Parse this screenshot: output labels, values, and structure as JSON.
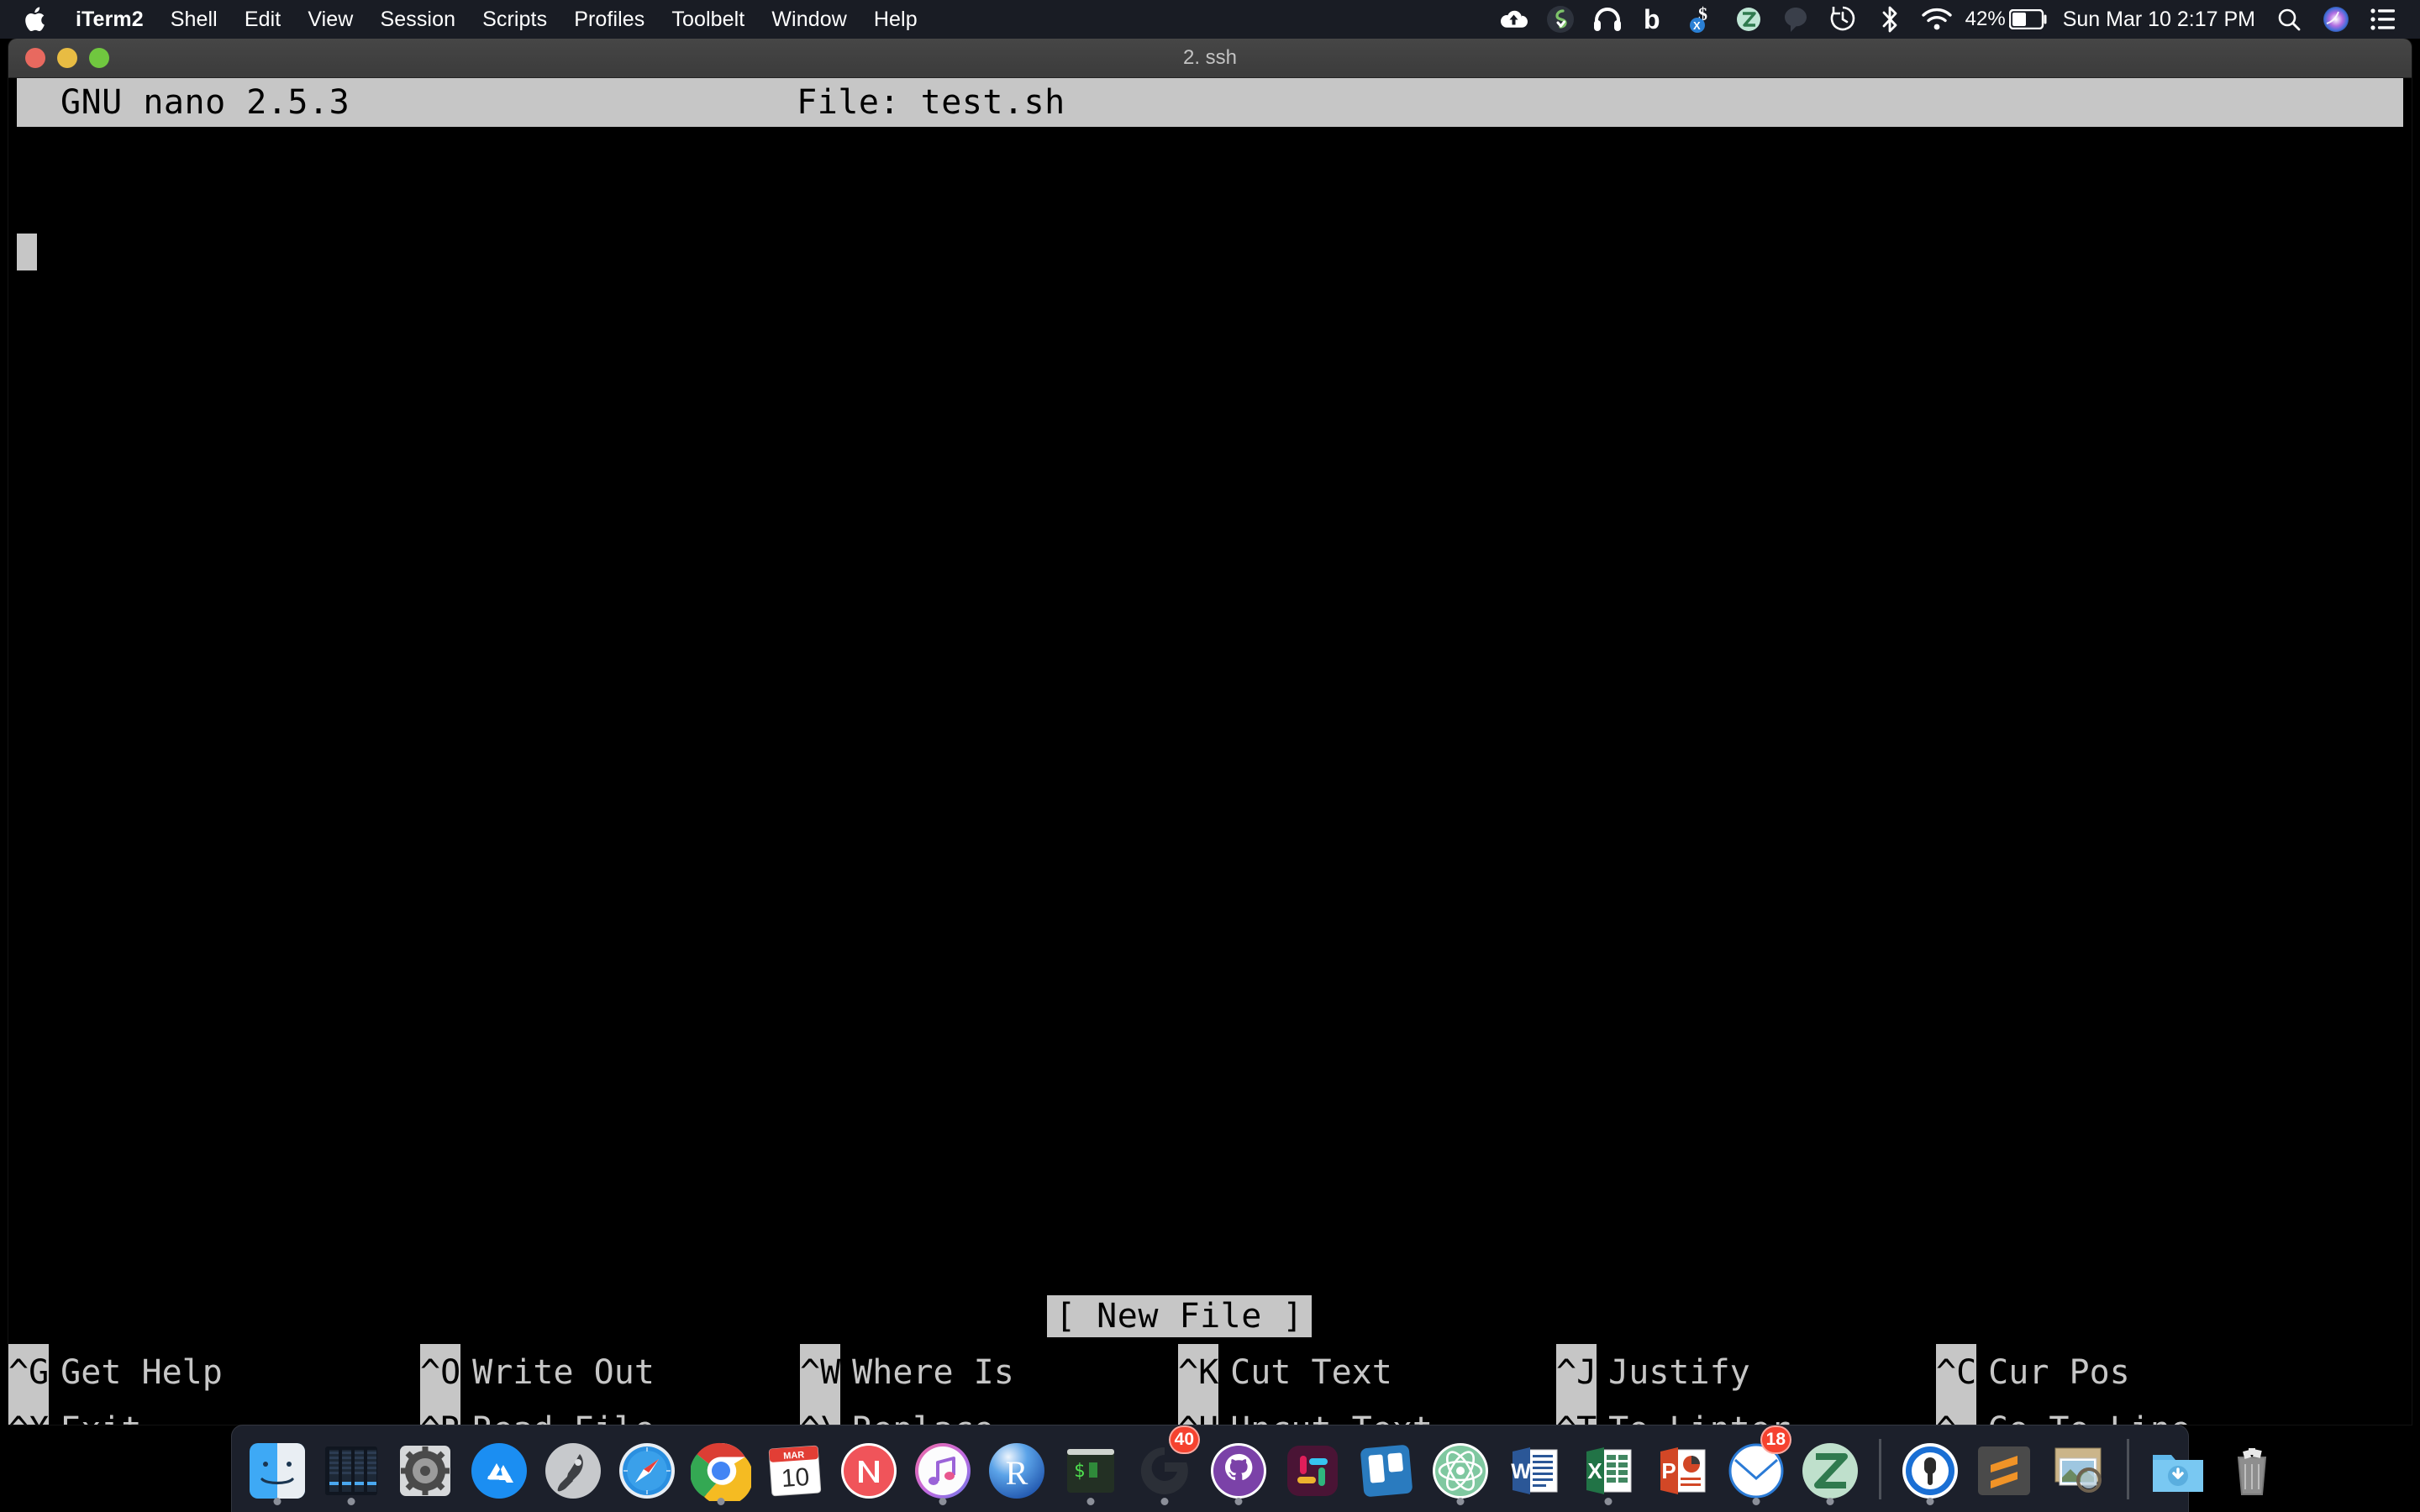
{
  "menubar": {
    "apple_icon": "apple-logo-icon",
    "items": [
      {
        "label": "iTerm2",
        "bold": true
      },
      {
        "label": "Shell",
        "bold": false
      },
      {
        "label": "Edit",
        "bold": false
      },
      {
        "label": "View",
        "bold": false
      },
      {
        "label": "Session",
        "bold": false
      },
      {
        "label": "Scripts",
        "bold": false
      },
      {
        "label": "Profiles",
        "bold": false
      },
      {
        "label": "Toolbelt",
        "bold": false
      },
      {
        "label": "Window",
        "bold": false
      },
      {
        "label": "Help",
        "bold": false
      }
    ],
    "status_icons": [
      {
        "name": "cloud-upload-icon"
      },
      {
        "name": "spotify-like-green-s-icon"
      },
      {
        "name": "headphones-icon"
      },
      {
        "name": "backblaze-b-icon"
      },
      {
        "name": "dollar-sign-x-icon"
      },
      {
        "name": "zotero-z-icon"
      },
      {
        "name": "speech-bubble-icon"
      },
      {
        "name": "time-machine-clock-icon"
      },
      {
        "name": "bluetooth-icon"
      },
      {
        "name": "wifi-icon"
      }
    ],
    "battery_percent": "42%",
    "battery_icon": "battery-icon",
    "datetime": "Sun Mar 10  2:17 PM",
    "search_icon": "search-icon",
    "siri_icon": "siri-icon",
    "control_center_icon": "notification-center-icon"
  },
  "window": {
    "title": "2. ssh",
    "traffic_lights": [
      {
        "name": "close-button",
        "color": "#e8695f"
      },
      {
        "name": "minimize-button",
        "color": "#e8bc43"
      },
      {
        "name": "zoom-button",
        "color": "#70c73f"
      }
    ]
  },
  "nano": {
    "version_text": "GNU nano 2.5.3",
    "file_text": "File: test.sh",
    "status_message": "[ New File ]",
    "buffer_lines": [],
    "colors": {
      "background": "#000000",
      "inverted_background": "#c6c6c6",
      "foreground": "#c6c6c6",
      "inverted_foreground": "#000000"
    },
    "shortcuts_row1": [
      {
        "key": "^G",
        "label": "Get Help"
      },
      {
        "key": "^O",
        "label": "Write Out"
      },
      {
        "key": "^W",
        "label": "Where Is"
      },
      {
        "key": "^K",
        "label": "Cut Text"
      },
      {
        "key": "^J",
        "label": "Justify"
      },
      {
        "key": "^C",
        "label": "Cur Pos"
      }
    ],
    "shortcuts_row2": [
      {
        "key": "^X",
        "label": "Exit"
      },
      {
        "key": "^R",
        "label": "Read File"
      },
      {
        "key": "^\\",
        "label": "Replace"
      },
      {
        "key": "^U",
        "label": "Uncut Text"
      },
      {
        "key": "^T",
        "label": "To Linter"
      },
      {
        "key": "^_",
        "label": "Go To Line"
      }
    ]
  },
  "dock": {
    "items": [
      {
        "name": "finder",
        "icon": "finder-icon",
        "running": true
      },
      {
        "name": "activity-monitor",
        "icon": "activity-monitor-icon",
        "running": true
      },
      {
        "name": "system-preferences",
        "icon": "system-preferences-icon",
        "running": false
      },
      {
        "name": "app-store",
        "icon": "app-store-icon",
        "running": false
      },
      {
        "name": "launchpad",
        "icon": "launchpad-icon",
        "running": false
      },
      {
        "name": "safari",
        "icon": "safari-icon",
        "running": false
      },
      {
        "name": "google-chrome",
        "icon": "chrome-icon",
        "running": true
      },
      {
        "name": "calendar",
        "icon": "calendar-icon",
        "running": false,
        "month": "MAR",
        "day": "10"
      },
      {
        "name": "news",
        "icon": "news-icon",
        "running": false
      },
      {
        "name": "itunes",
        "icon": "itunes-icon",
        "running": true
      },
      {
        "name": "rstudio",
        "icon": "rstudio-icon",
        "running": false
      },
      {
        "name": "iterm2",
        "icon": "terminal-icon",
        "running": true
      },
      {
        "name": "gmail",
        "icon": "gmail-g-icon",
        "running": true,
        "badge": "40"
      },
      {
        "name": "github-desktop",
        "icon": "github-icon",
        "running": true
      },
      {
        "name": "slack",
        "icon": "slack-icon",
        "running": false
      },
      {
        "name": "trello",
        "icon": "trello-icon",
        "running": false
      },
      {
        "name": "atom",
        "icon": "atom-icon",
        "running": true
      },
      {
        "name": "microsoft-word",
        "icon": "word-icon",
        "running": false
      },
      {
        "name": "microsoft-excel",
        "icon": "excel-icon",
        "running": true
      },
      {
        "name": "microsoft-powerpoint",
        "icon": "powerpoint-icon",
        "running": false
      },
      {
        "name": "outlook",
        "icon": "outlook-icon",
        "running": true,
        "badge": "18"
      },
      {
        "name": "zotero",
        "icon": "zotero-icon",
        "running": true
      },
      {
        "name": "separator-1",
        "icon": "dock-divider",
        "running": false
      },
      {
        "name": "1password",
        "icon": "1password-icon",
        "running": true
      },
      {
        "name": "sublime-text",
        "icon": "sublime-text-icon",
        "running": false
      },
      {
        "name": "preview",
        "icon": "preview-icon",
        "running": false
      },
      {
        "name": "separator-2",
        "icon": "dock-divider",
        "running": false
      },
      {
        "name": "downloads-folder",
        "icon": "downloads-folder-icon",
        "running": false
      },
      {
        "name": "trash",
        "icon": "trash-icon",
        "running": false
      }
    ]
  }
}
